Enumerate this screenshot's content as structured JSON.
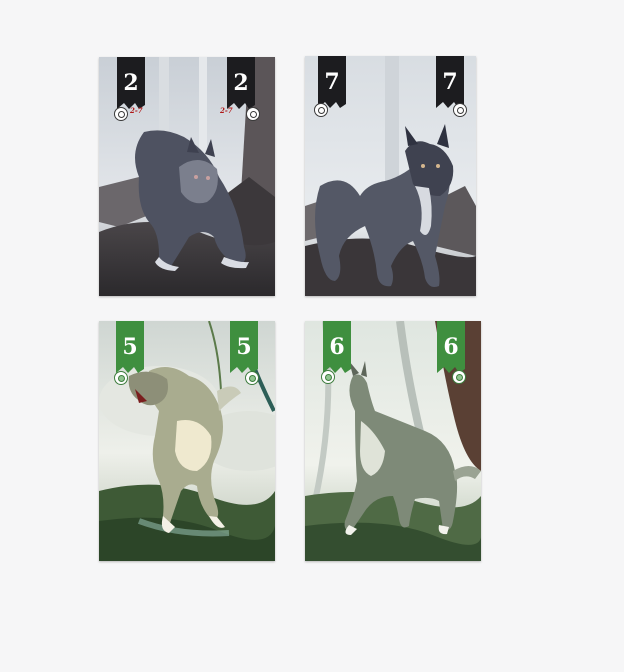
{
  "cards": [
    {
      "value": "2",
      "subtag": "2-7",
      "theme": "grey",
      "accent": "#1c1c1f"
    },
    {
      "value": "7",
      "theme": "grey",
      "accent": "#1c1c1f"
    },
    {
      "value": "5",
      "theme": "green",
      "accent": "#3f8f3f"
    },
    {
      "value": "6",
      "theme": "green",
      "accent": "#3f8f3f"
    }
  ],
  "colors": {
    "background": "#f6f6f7"
  }
}
